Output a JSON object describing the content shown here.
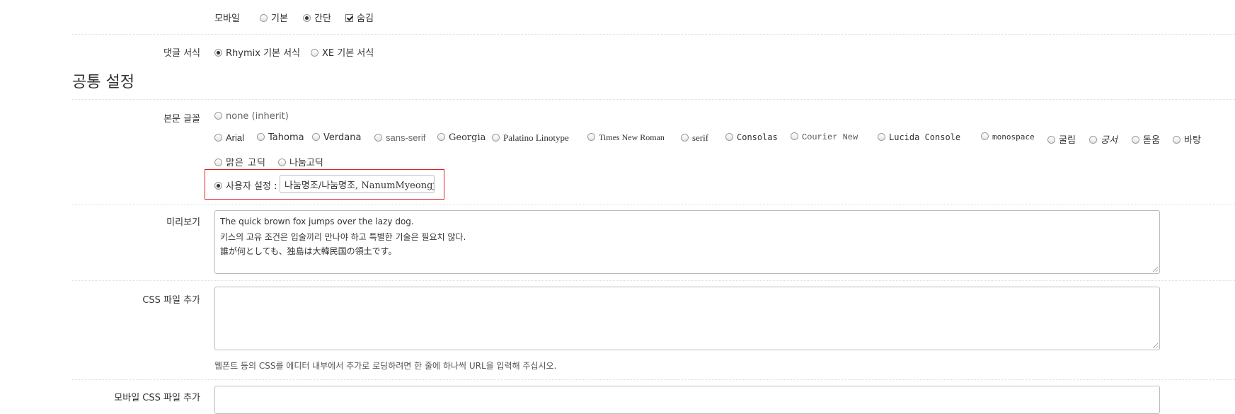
{
  "mobile_row": {
    "label": "모바일",
    "options": [
      {
        "label": "기본",
        "checked": false,
        "kind": "radio"
      },
      {
        "label": "간단",
        "checked": true,
        "kind": "radio"
      },
      {
        "label": "숨김",
        "checked": true,
        "kind": "checkbox"
      }
    ]
  },
  "comment_format": {
    "label": "댓글 서식",
    "options": [
      {
        "label": "Rhymix 기본 서식",
        "checked": true
      },
      {
        "label": "XE 기본 서식",
        "checked": false
      }
    ]
  },
  "section_title": "공통 설정",
  "body_font": {
    "label": "본문 글꼴",
    "row1": [
      {
        "label": "none (inherit)",
        "checked": false
      }
    ],
    "row2": [
      {
        "label": "Arial"
      },
      {
        "label": "Tahoma"
      },
      {
        "label": "Verdana"
      },
      {
        "label": "sans-serif"
      },
      {
        "label": "Georgia"
      },
      {
        "label": "Palatino Linotype"
      },
      {
        "label": "Times New Roman"
      },
      {
        "label": "serif"
      },
      {
        "label": "Consolas"
      },
      {
        "label": "Courier New"
      },
      {
        "label": "Lucida Console"
      },
      {
        "label": "monospace"
      },
      {
        "label": "굴림"
      },
      {
        "label": "궁서"
      },
      {
        "label": "돋움"
      },
      {
        "label": "바탕"
      }
    ],
    "row3": [
      {
        "label": "맑은 고딕"
      },
      {
        "label": "나눔고딕"
      }
    ],
    "custom_label": "사용자 설정 :",
    "custom_checked": true,
    "custom_value": "나눔명조/나눔명조, NanumMyeongjo"
  },
  "preview": {
    "label": "미리보기",
    "lines": [
      "The quick brown fox jumps over the lazy dog.",
      "키스의 고유 조건은 입술끼리 만나야 하고 특별한 기술은 필요치 않다.",
      "誰が何としても、独島は大韓民国の領土です。"
    ]
  },
  "css_file": {
    "label": "CSS 파일 추가",
    "value": "",
    "help": "웹폰트 등의 CSS를 에디터 내부에서 추가로 로딩하려면 한 줄에 하나씩 URL을 입력해 주십시오."
  },
  "mobile_css_file": {
    "label": "모바일 CSS 파일 추가"
  }
}
